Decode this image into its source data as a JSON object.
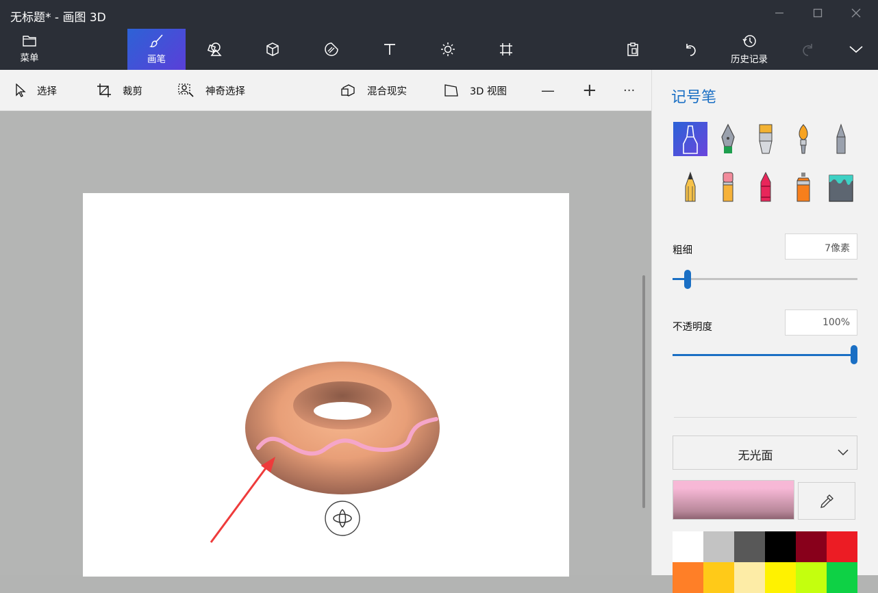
{
  "window": {
    "title": "无标题* - 画图 3D",
    "controls": [
      "minimize-icon",
      "maximize-icon",
      "close-icon"
    ]
  },
  "topbar": {
    "menu_label": "菜单",
    "brushes_label": "画笔",
    "history_label": "历史记录",
    "tools": [
      "2d-shapes-icon",
      "3d-shapes-icon",
      "stickers-icon",
      "text-icon",
      "effects-icon",
      "canvas-icon",
      "paste-icon",
      "undo-icon",
      "redo-icon",
      "expand-icon"
    ]
  },
  "toolbar2": {
    "select_label": "选择",
    "crop_label": "裁剪",
    "magic_select_label": "神奇选择",
    "mixed_reality_label": "混合现实",
    "view3d_label": "3D 视图",
    "zoom_out_label": "—",
    "zoom_in_label": "+",
    "more_label": "···"
  },
  "panel": {
    "title": "记号笔",
    "brushes": [
      "marker",
      "calligraphy-pen",
      "oil-brush",
      "watercolor",
      "pixel-pen",
      "pencil",
      "eraser",
      "crayon",
      "spraycan",
      "fill"
    ],
    "thickness_label": "粗细",
    "thickness_value": "7像素",
    "thickness_level": 0.08,
    "opacity_label": "不透明度",
    "opacity_value": "100%",
    "opacity_level": 1.0,
    "finish_value": "无光面",
    "current_color": "#f7b8d6",
    "palette": [
      "#ffffff",
      "#c3c3c3",
      "#585858",
      "#000000",
      "#88001b",
      "#ec1c24",
      "#ff7f27",
      "#ffca18",
      "#fdeca6",
      "#fff200",
      "#c4ff0e",
      "#0ed145"
    ]
  }
}
